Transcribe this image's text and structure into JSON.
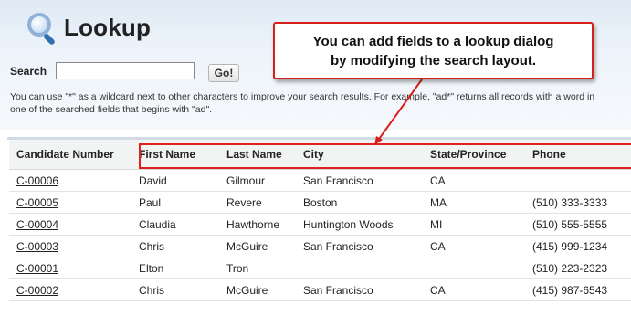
{
  "header": {
    "title": "Lookup",
    "icon": "magnifier-icon"
  },
  "search": {
    "label": "Search",
    "value": "",
    "button_label": "Go!"
  },
  "help_text": "You can use \"*\" as a wildcard next to other characters to improve your search results. For example, \"ad*\" returns all records with a word in one of the searched fields that begins with \"ad\".",
  "callout": {
    "line1": "You can add fields to a lookup dialog",
    "line2": "by modifying the search layout.",
    "border_color": "#d7201c"
  },
  "table": {
    "columns": [
      "Candidate Number",
      "First Name",
      "Last Name",
      "City",
      "State/Province",
      "Phone"
    ],
    "rows": [
      [
        "C-00006",
        "David",
        "Gilmour",
        "San Francisco",
        "CA",
        ""
      ],
      [
        "C-00005",
        "Paul",
        "Revere",
        "Boston",
        "MA",
        "(510) 333-3333"
      ],
      [
        "C-00004",
        "Claudia",
        "Hawthorne",
        "Huntington Woods",
        "MI",
        "(510) 555-5555"
      ],
      [
        "C-00003",
        "Chris",
        "McGuire",
        "San Francisco",
        "CA",
        "(415) 999-1234"
      ],
      [
        "C-00001",
        "Elton",
        "Tron",
        "",
        "",
        "(510) 223-2323"
      ],
      [
        "C-00002",
        "Chris",
        "McGuire",
        "San Francisco",
        "CA",
        "(415) 987-6543"
      ]
    ]
  }
}
